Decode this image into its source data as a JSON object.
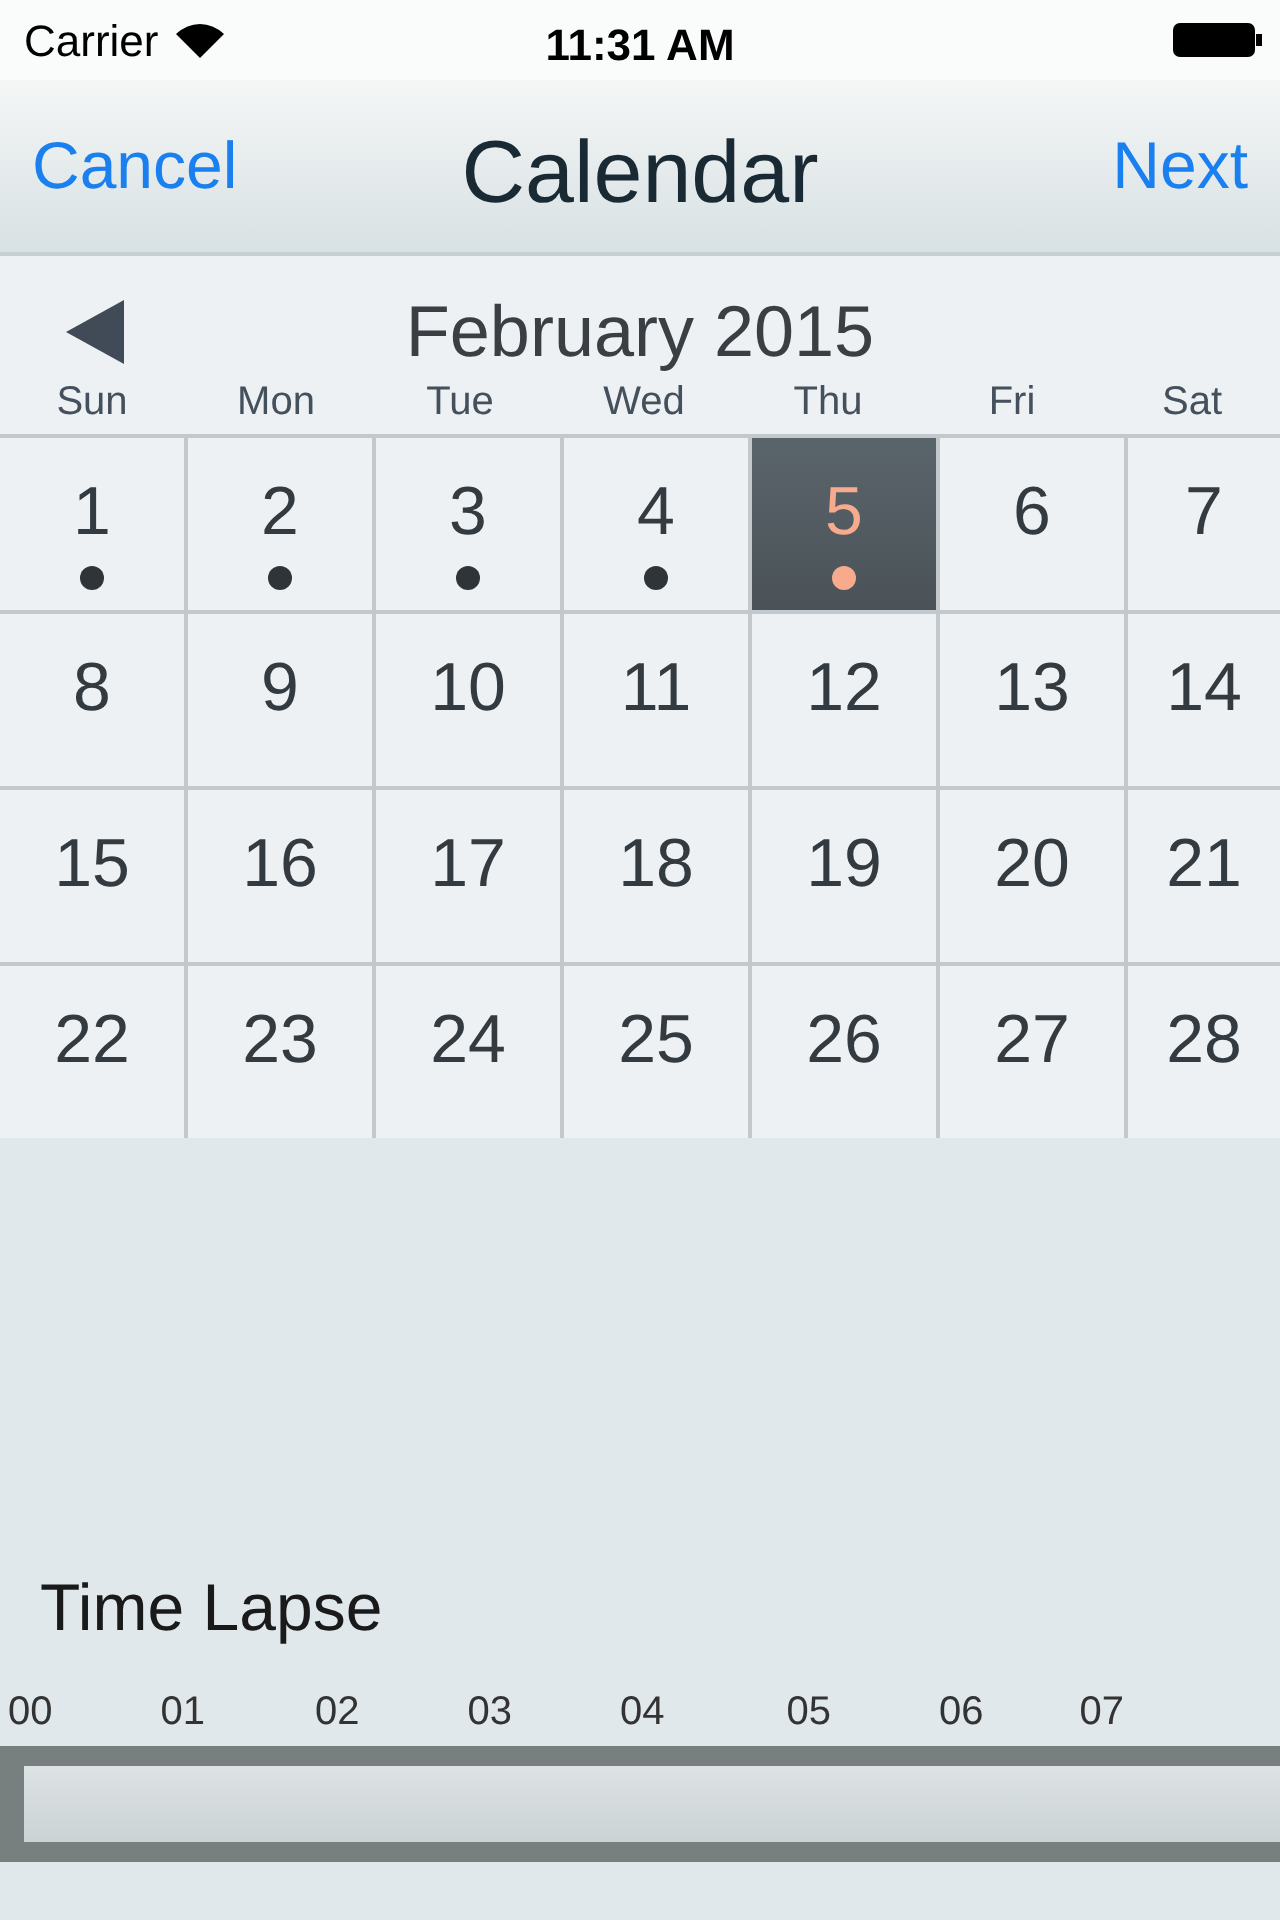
{
  "status_bar": {
    "carrier": "Carrier",
    "time": "11:31 AM"
  },
  "nav_bar": {
    "left": "Cancel",
    "title": "Calendar",
    "right": "Next"
  },
  "calendar": {
    "month": "February 2015",
    "weekdays": [
      "Sun",
      "Mon",
      "Tue",
      "Wed",
      "Thu",
      "Fri",
      "Sat"
    ],
    "days": [
      {
        "label": "1",
        "selected": false,
        "has_event": true
      },
      {
        "label": "2",
        "selected": false,
        "has_event": true
      },
      {
        "label": "3",
        "selected": false,
        "has_event": true
      },
      {
        "label": "4",
        "selected": false,
        "has_event": true
      },
      {
        "label": "5",
        "selected": true,
        "has_event": true
      },
      {
        "label": "6",
        "selected": false,
        "has_event": false
      },
      {
        "label": "7",
        "selected": false,
        "has_event": false
      },
      {
        "label": "8",
        "selected": false,
        "has_event": false
      },
      {
        "label": "9",
        "selected": false,
        "has_event": false
      },
      {
        "label": "10",
        "selected": false,
        "has_event": false
      },
      {
        "label": "11",
        "selected": false,
        "has_event": false
      },
      {
        "label": "12",
        "selected": false,
        "has_event": false
      },
      {
        "label": "13",
        "selected": false,
        "has_event": false
      },
      {
        "label": "14",
        "selected": false,
        "has_event": false
      },
      {
        "label": "15",
        "selected": false,
        "has_event": false
      },
      {
        "label": "16",
        "selected": false,
        "has_event": false
      },
      {
        "label": "17",
        "selected": false,
        "has_event": false
      },
      {
        "label": "18",
        "selected": false,
        "has_event": false
      },
      {
        "label": "19",
        "selected": false,
        "has_event": false
      },
      {
        "label": "20",
        "selected": false,
        "has_event": false
      },
      {
        "label": "21",
        "selected": false,
        "has_event": false
      },
      {
        "label": "22",
        "selected": false,
        "has_event": false
      },
      {
        "label": "23",
        "selected": false,
        "has_event": false
      },
      {
        "label": "24",
        "selected": false,
        "has_event": false
      },
      {
        "label": "25",
        "selected": false,
        "has_event": false
      },
      {
        "label": "26",
        "selected": false,
        "has_event": false
      },
      {
        "label": "27",
        "selected": false,
        "has_event": false
      },
      {
        "label": "28",
        "selected": false,
        "has_event": false
      }
    ]
  },
  "time_lapse": {
    "title": "Time Lapse",
    "hours": [
      "00",
      "01",
      "02",
      "03",
      "04",
      "05",
      "06",
      "07"
    ]
  }
}
